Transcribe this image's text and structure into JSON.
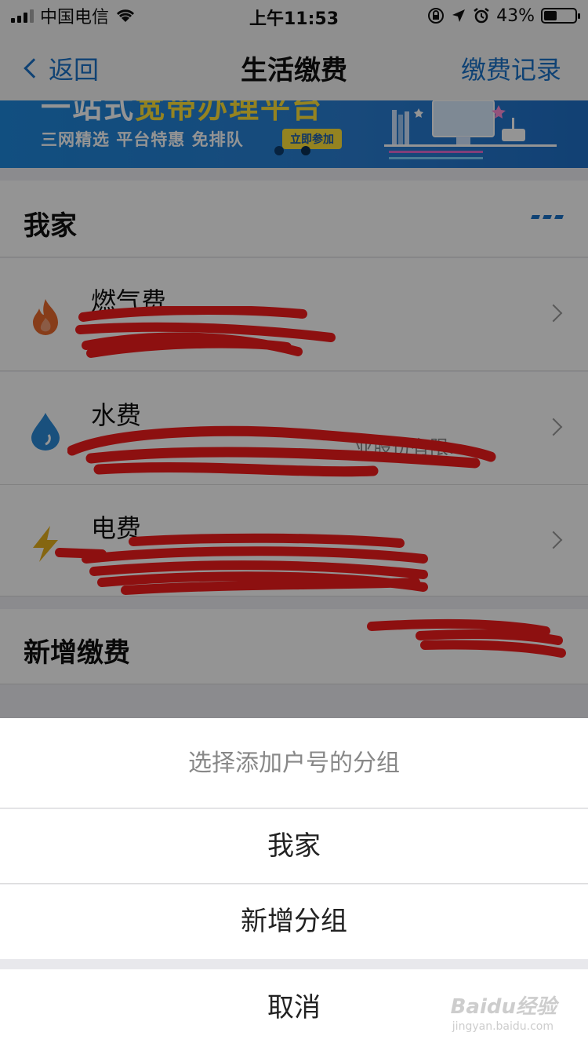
{
  "status_bar": {
    "carrier": "中国电信",
    "time": "上午11:53",
    "battery": "43%",
    "battery_level": 0.43
  },
  "nav": {
    "back_label": "返回",
    "title": "生活缴费",
    "right_label": "缴费记录"
  },
  "banner": {
    "headline_part1": "一站式",
    "headline_part2": "宽带办理平台",
    "subtitle": "三网精选  平台特惠  免排队",
    "cta": "立即参加",
    "page_count": 2,
    "active_page": 2
  },
  "group": {
    "title": "我家"
  },
  "bills": [
    {
      "title": "燃气费",
      "subtitle": "",
      "icon": "flame-icon",
      "color": "#e8692e"
    },
    {
      "title": "水费",
      "subtitle": "业股份有限…",
      "icon": "water-drop-icon",
      "color": "#2b8ad8"
    },
    {
      "title": "电费",
      "subtitle": "",
      "icon": "lightning-icon",
      "color": "#e5b01c"
    }
  ],
  "new_payment": {
    "title": "新增缴费"
  },
  "sheet": {
    "title": "选择添加户号的分组",
    "options": [
      "我家",
      "新增分组"
    ],
    "cancel": "取消"
  },
  "watermark": {
    "brand": "Baidu经验",
    "url": "jingyan.baidu.com"
  }
}
